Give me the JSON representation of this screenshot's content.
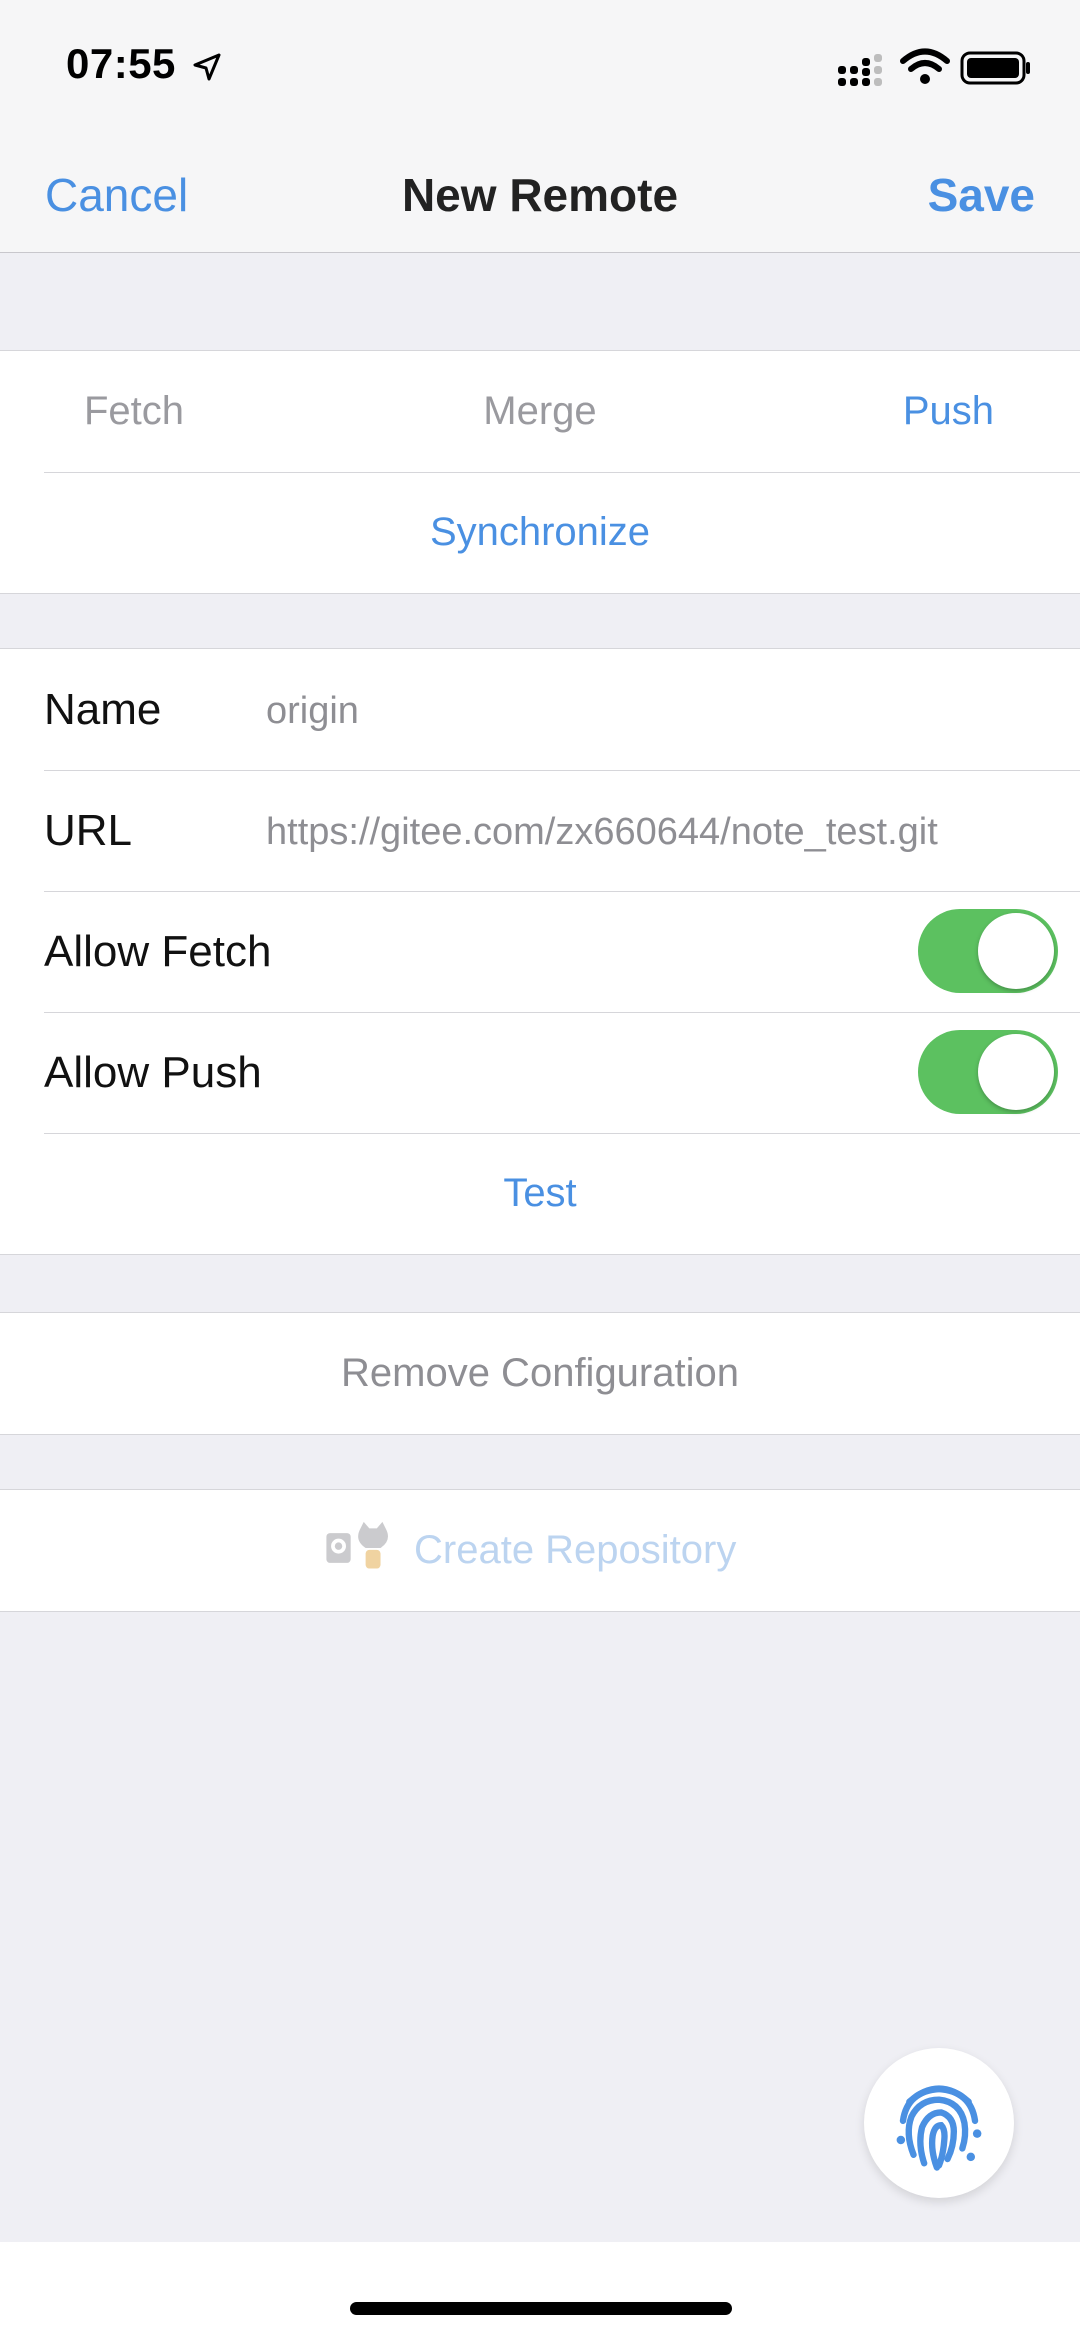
{
  "status": {
    "time": "07:55",
    "icons": [
      "location-arrow-icon",
      "cellular-signal-icon",
      "wifi-icon",
      "battery-icon"
    ]
  },
  "nav": {
    "cancel": "Cancel",
    "title": "New Remote",
    "save": "Save"
  },
  "sync_section": {
    "tabs": [
      {
        "label": "Fetch",
        "state": "disabled"
      },
      {
        "label": "Merge",
        "state": "disabled"
      },
      {
        "label": "Push",
        "state": "enabled"
      }
    ],
    "synchronize": "Synchronize"
  },
  "remote_form": {
    "name_label": "Name",
    "name_value": "origin",
    "url_label": "URL",
    "url_value": "https://gitee.com/zx660644/note_test.git",
    "allow_fetch_label": "Allow Fetch",
    "allow_fetch_on": true,
    "allow_push_label": "Allow Push",
    "allow_push_on": true,
    "test": "Test"
  },
  "remove": {
    "label": "Remove Configuration"
  },
  "create": {
    "label": "Create Repository",
    "icon": "git-hosting-logo-icon"
  },
  "fab": {
    "icon": "fingerprint-icon"
  },
  "colors": {
    "accent": "#4a90e2",
    "toggle_on": "#5cc160",
    "disabled_text": "#9a9a9f",
    "background": "#efeff4"
  }
}
